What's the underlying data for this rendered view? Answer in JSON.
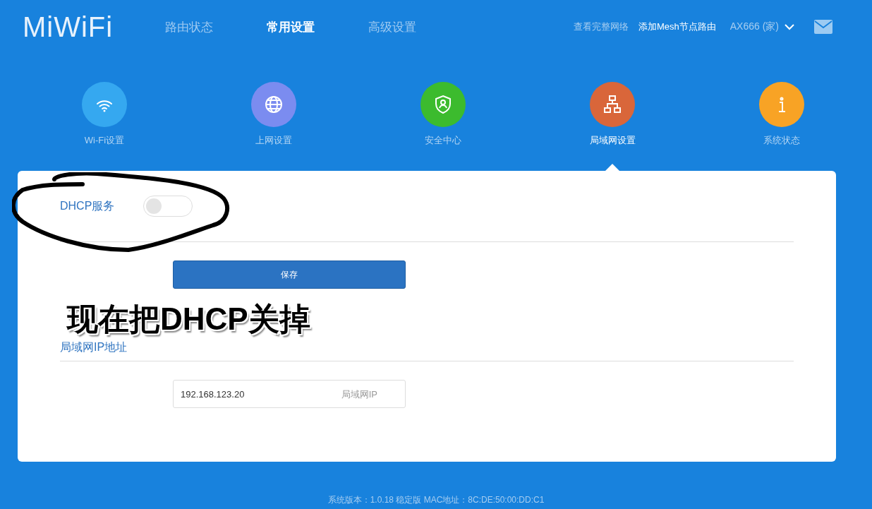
{
  "header": {
    "logo": "MiWiFi",
    "nav": [
      {
        "label": "路由状态",
        "selected": false
      },
      {
        "label": "常用设置",
        "selected": true
      },
      {
        "label": "高级设置",
        "selected": false
      }
    ],
    "links": [
      {
        "label": "查看完整网络",
        "kind": "muted"
      },
      {
        "label": "添加Mesh节点路由",
        "kind": "bright"
      }
    ],
    "router": "AX666 (家)"
  },
  "categories": [
    {
      "label": "Wi-Fi设置",
      "color": "#35a8f0",
      "selected": false
    },
    {
      "label": "上网设置",
      "color": "#7b8cf0",
      "selected": false
    },
    {
      "label": "安全中心",
      "color": "#3cbb2e",
      "selected": false
    },
    {
      "label": "局域网设置",
      "color": "#d9663a",
      "selected": true
    },
    {
      "label": "系统状态",
      "color": "#f8a325",
      "selected": false
    }
  ],
  "dhcp": {
    "label": "DHCP服务",
    "on": false,
    "save": "保存"
  },
  "annotation": "现在把DHCP关掉",
  "lan": {
    "label": "局域网IP地址",
    "value": "192.168.123.20",
    "hint": "局域网IP"
  },
  "footer": "系统版本：1.0.18 稳定版  MAC地址：8C:DE:50:00:DD:C1"
}
